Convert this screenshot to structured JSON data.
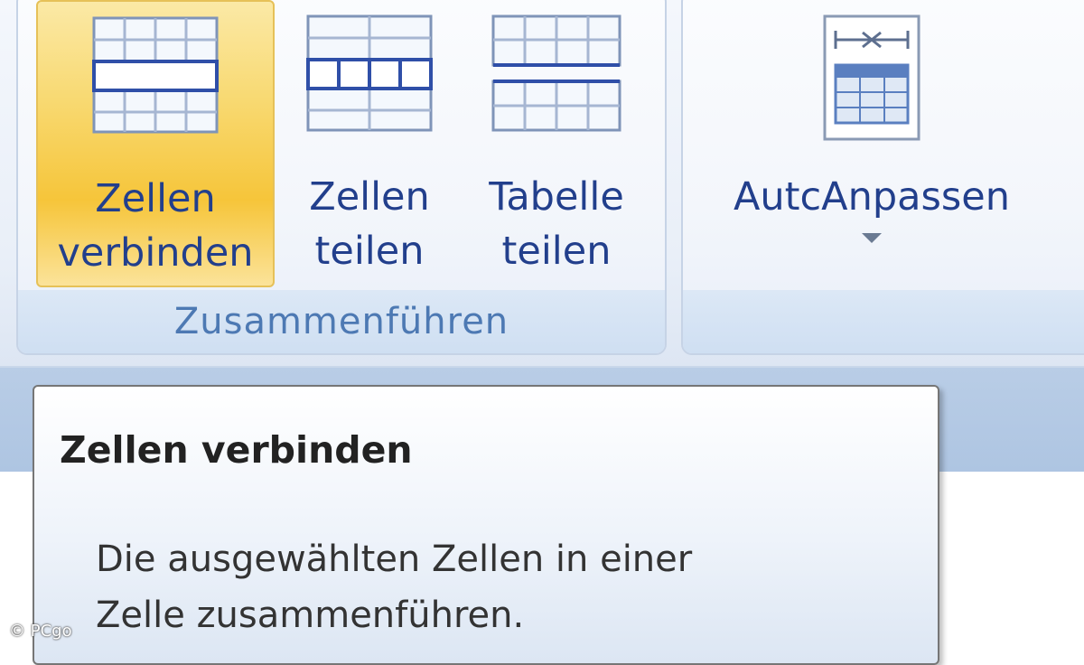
{
  "ribbon": {
    "merge_group": {
      "label": "Zusammenführen",
      "buttons": [
        {
          "id": "merge-cells",
          "line1": "Zellen",
          "line2": "verbinden",
          "icon": "merge-cells-icon"
        },
        {
          "id": "split-cells",
          "line1": "Zellen",
          "line2": "teilen",
          "icon": "split-cells-icon"
        },
        {
          "id": "split-table",
          "line1": "Tabelle",
          "line2": "teilen",
          "icon": "split-table-icon"
        }
      ]
    },
    "size_group": {
      "autofit_label": "AutcAnpassen",
      "icon": "autofit-table-icon"
    }
  },
  "tooltip": {
    "title": "Zellen verbinden",
    "description_line1": "Die ausgewählten Zellen in einer",
    "description_line2": "Zelle zusammenführen."
  },
  "watermark": "© PCgo",
  "colors": {
    "label_text": "#223f8c",
    "group_label_text": "#4d79b3",
    "active_button": "#f8d971",
    "icon_line": "#2f4fa8"
  }
}
